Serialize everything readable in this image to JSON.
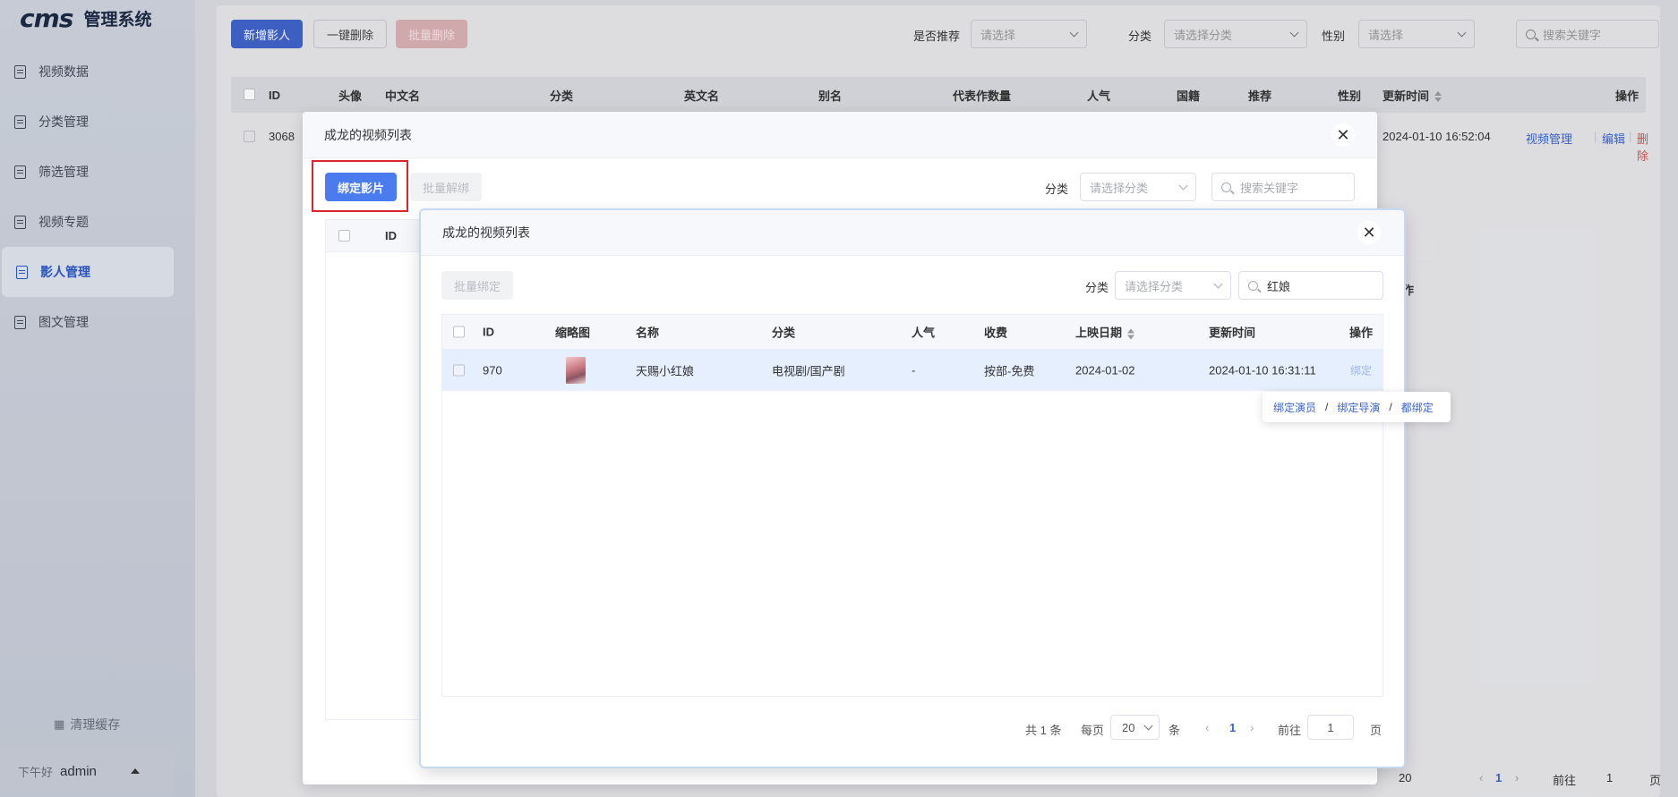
{
  "app": {
    "logo": "cms",
    "title": "管理系统"
  },
  "sidebar": {
    "items": [
      {
        "label": "视频数据"
      },
      {
        "label": "分类管理"
      },
      {
        "label": "筛选管理"
      },
      {
        "label": "视频专题"
      },
      {
        "label": "影人管理",
        "active": true
      },
      {
        "label": "图文管理"
      }
    ],
    "clear_cache": "清理缓存",
    "greeting": "下午好",
    "username": "admin"
  },
  "toolbar": {
    "add": "新增影人",
    "delete_all": "一键删除",
    "batch_delete": "批量删除",
    "recommend_label": "是否推荐",
    "recommend_placeholder": "请选择",
    "category_label": "分类",
    "category_placeholder": "请选择分类",
    "gender_label": "性别",
    "gender_placeholder": "请选择",
    "search_placeholder": "搜索关键字"
  },
  "table": {
    "columns": [
      "ID",
      "头像",
      "中文名",
      "分类",
      "英文名",
      "别名",
      "代表作数量",
      "人气",
      "国籍",
      "推荐",
      "性别",
      "更新时间",
      "操作"
    ],
    "rows": [
      {
        "id": "3068",
        "updated": "2024-01-10 16:52:04",
        "actions": [
          "视频管理",
          "编辑",
          "删除"
        ]
      }
    ]
  },
  "base_pager": {
    "size": "20",
    "current": "1",
    "goto": "前往",
    "goto_value": "1",
    "page": "页"
  },
  "dialog1": {
    "title": "成龙的视频列表",
    "bind_button": "绑定影片",
    "unbind_button": "批量解绑",
    "category_label": "分类",
    "category_placeholder": "请选择分类",
    "search_placeholder": "搜索关键字",
    "col_id": "ID",
    "peek_col": "作"
  },
  "dialog2": {
    "title": "成龙的视频列表",
    "batch_bind": "批量绑定",
    "category_label": "分类",
    "category_placeholder": "请选择分类",
    "search_value": "红娘",
    "columns": [
      "ID",
      "缩略图",
      "名称",
      "分类",
      "人气",
      "收费",
      "上映日期",
      "更新时间",
      "操作"
    ],
    "rows": [
      {
        "id": "970",
        "name": "天赐小红娘",
        "category": "电视剧/国产剧",
        "popularity": "-",
        "fee": "按部-免费",
        "release": "2024-01-02",
        "updated": "2024-01-10 16:31:11",
        "action": "绑定"
      }
    ],
    "pager": {
      "total": "共 1 条",
      "per_page": "每页",
      "size": "20",
      "unit": "条",
      "current": "1",
      "goto": "前往",
      "goto_value": "1",
      "page": "页"
    }
  },
  "popover": {
    "items": [
      "绑定演员",
      "绑定导演",
      "都绑定"
    ],
    "separator": "/"
  }
}
